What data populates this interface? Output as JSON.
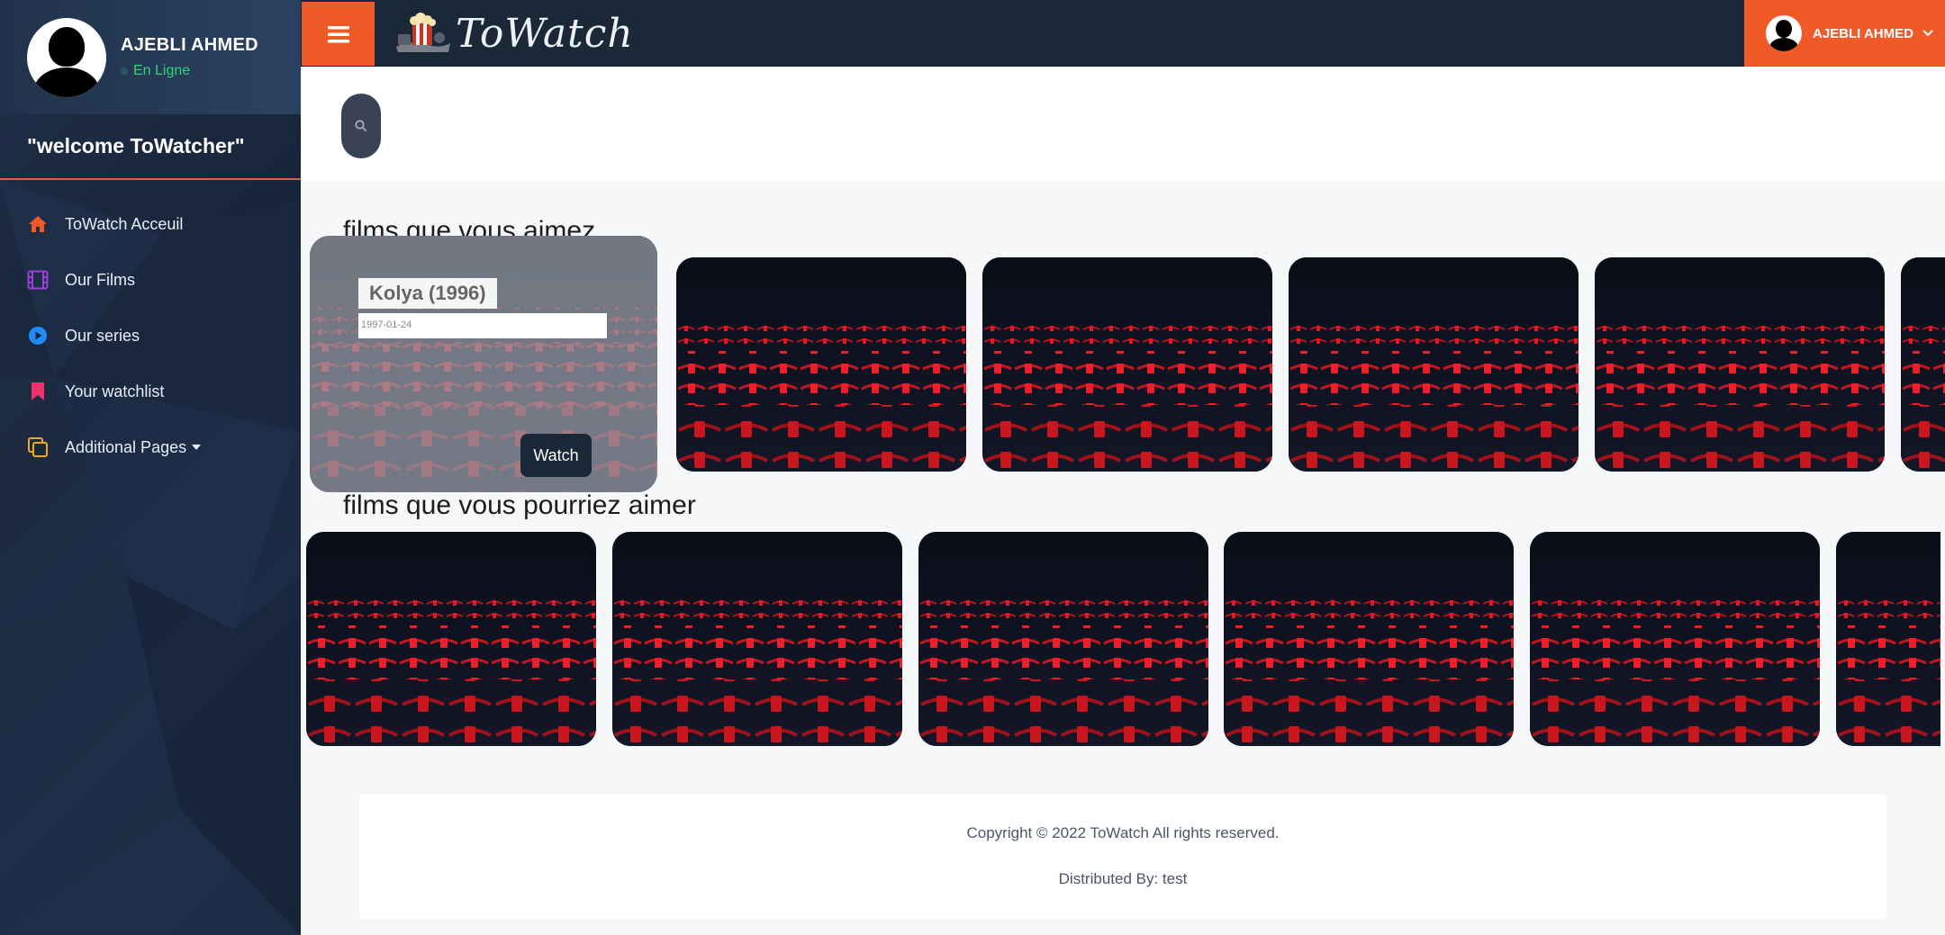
{
  "sidebar": {
    "user_name": "AJEBLI AHMED",
    "status": "En Ligne",
    "welcome": "\"welcome ToWatcher\"",
    "items": [
      {
        "label": "ToWatch Acceuil",
        "icon": "home-icon",
        "color": "#f05a28"
      },
      {
        "label": "Our Films",
        "icon": "film-icon",
        "color": "#9b3fd6"
      },
      {
        "label": "Our series",
        "icon": "play-circle-icon",
        "color": "#1d8cf8"
      },
      {
        "label": "Your watchlist",
        "icon": "bookmark-icon",
        "color": "#f0306a"
      },
      {
        "label": "Additional Pages",
        "icon": "copy-icon",
        "color": "#f5a623"
      }
    ]
  },
  "topbar": {
    "logo_text": "ToWatch",
    "user_name": "AJEBLI AHMED"
  },
  "sections": {
    "liked_title": "films que vous aimez",
    "suggested_title": "films que vous pourriez aimer"
  },
  "hover_card": {
    "title": "Kolya (1996)",
    "date": "1997-01-24",
    "watch_label": "Watch"
  },
  "footer": {
    "copyright": "Copyright © 2022 ToWatch All rights reserved.",
    "distributed": "Distributed By: test"
  },
  "colors": {
    "accent": "#f05a28",
    "sidebar_bg": "#1b2838",
    "status": "#2ed47a"
  }
}
